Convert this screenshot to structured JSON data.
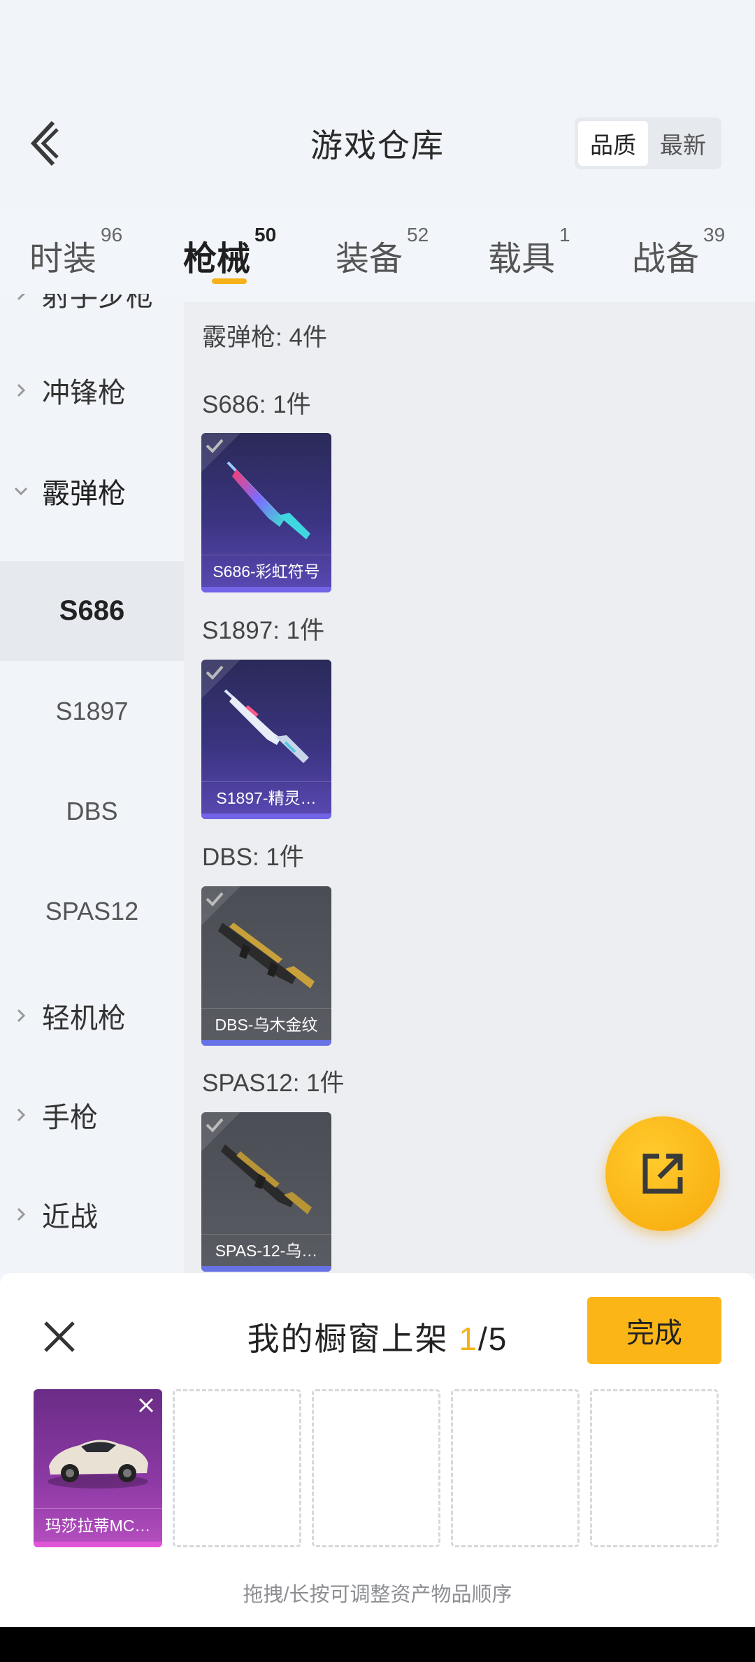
{
  "header": {
    "title": "游戏仓库",
    "sort_options": [
      "品质",
      "最新"
    ],
    "active_sort": "品质"
  },
  "tabs": [
    {
      "label": "时装",
      "count": "96"
    },
    {
      "label": "枪械",
      "count": "50",
      "active": true
    },
    {
      "label": "装备",
      "count": "52"
    },
    {
      "label": "载具",
      "count": "1"
    },
    {
      "label": "战备",
      "count": "39"
    }
  ],
  "sidebar": {
    "categories": [
      {
        "label": "射手步枪"
      },
      {
        "label": "冲锋枪"
      },
      {
        "label": "霰弹枪",
        "expanded": true
      },
      {
        "label": "轻机枪"
      },
      {
        "label": "手枪"
      },
      {
        "label": "近战"
      }
    ],
    "subitems": [
      "S686",
      "S1897",
      "DBS",
      "SPAS12"
    ],
    "active_subitem": "S686"
  },
  "content": {
    "section_total": "霰弹枪: 4件",
    "groups": [
      {
        "title": "S686: 1件",
        "item": "S686-彩虹符号"
      },
      {
        "title": "S1897: 1件",
        "item": "S1897-精灵…"
      },
      {
        "title": "DBS: 1件",
        "item": "DBS-乌木金纹"
      },
      {
        "title": "SPAS12: 1件",
        "item": "SPAS-12-乌…"
      }
    ]
  },
  "panel": {
    "title_prefix": "我的橱窗上架 ",
    "count_current": "1",
    "count_total": "/5",
    "done_label": "完成",
    "slot_item": "玛莎拉蒂MC…",
    "hint": "拖拽/长按可调整资产物品顺序"
  },
  "colors": {
    "accent": "#fbb517",
    "tab_indicator": "#f6b21a",
    "card_purple": "#3b3481",
    "card_grey": "#55575e",
    "slot_legendary": "#8e3aa6"
  },
  "icons": [
    "back-arrow-icon",
    "chevron-right-icon",
    "chevron-down-icon",
    "checkmark-icon",
    "share-icon",
    "close-icon"
  ]
}
